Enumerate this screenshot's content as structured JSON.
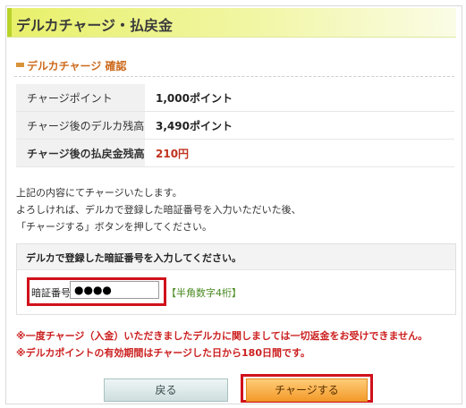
{
  "header": {
    "title": "デルカチャージ・払戻金"
  },
  "section": {
    "title": "デルカチャージ 確認"
  },
  "summary": {
    "rows": [
      {
        "label": "チャージポイント",
        "value": "1,000ポイント"
      },
      {
        "label": "チャージ後のデルカ残高",
        "value": "3,490ポイント"
      },
      {
        "label": "チャージ後の払戻金残高",
        "value": "210円"
      }
    ]
  },
  "instructions": {
    "line1": "上記の内容にてチャージいたします。",
    "line2": "よろしければ、デルカで登録した暗証番号を入力いただいた後、",
    "line3": "「チャージする」ボタンを押してください。"
  },
  "pin": {
    "heading": "デルカで登録した暗証番号を入力してください。",
    "label": "暗証番号",
    "value": "●●●●",
    "hint": "【半角数字4桁】"
  },
  "notices": {
    "refund": "※一度チャージ（入金）いただきましたデルカに関しましては一切返金をお受けできません。",
    "validity": "※デルカポイントの有効期間はチャージした日から180日間です。"
  },
  "buttons": {
    "back": "戻る",
    "charge": "チャージする"
  },
  "colors": {
    "accent": "#cc6a1d",
    "alert": "#cc1f1f",
    "highlight": "#d0111b"
  }
}
